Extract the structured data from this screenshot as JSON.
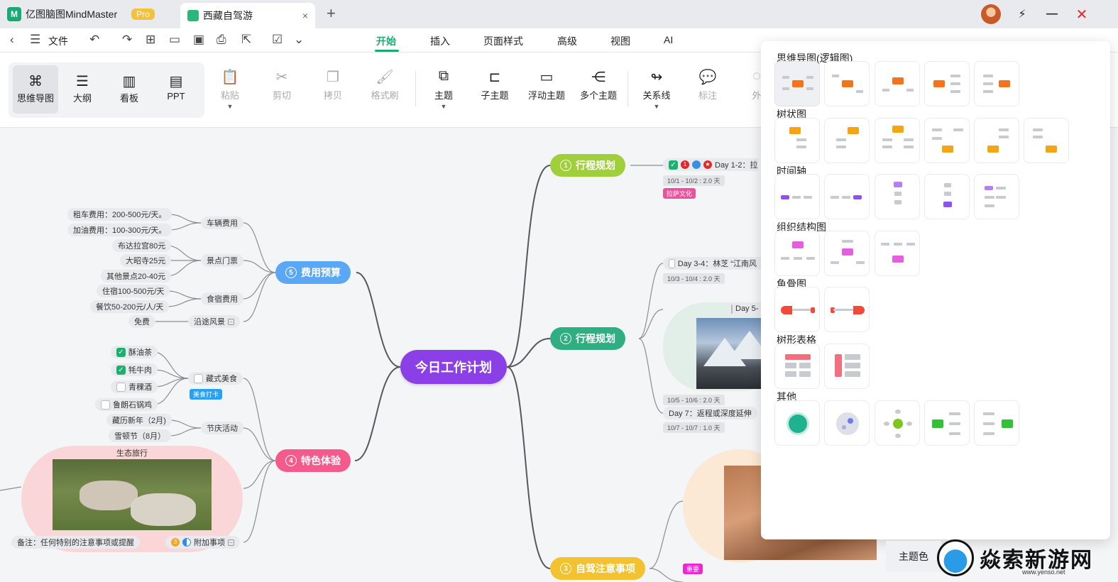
{
  "titlebar": {
    "app_name": "亿图脑图MindMaster",
    "pro_badge": "Pro",
    "doc_tab": "西藏自驾游",
    "close_symbol": "×",
    "new_tab_symbol": "+",
    "icons": [
      "app-logo-icon",
      "doc-icon",
      "avatar",
      "sync-icon",
      "minimize-icon",
      "close-icon"
    ]
  },
  "menubar": {
    "file": "文件",
    "tabs": [
      "开始",
      "插入",
      "页面样式",
      "高级",
      "视图",
      "AI"
    ],
    "active_tab": "开始",
    "accent": "#1aaa72"
  },
  "ribbon": {
    "views": [
      {
        "label": "思维导图",
        "icon": "mindmap-icon"
      },
      {
        "label": "大纲",
        "icon": "outline-icon"
      },
      {
        "label": "看板",
        "icon": "kanban-icon"
      },
      {
        "label": "PPT",
        "icon": "ppt-icon"
      }
    ],
    "tools": [
      {
        "label": "粘贴",
        "icon": "paste-icon",
        "enabled": false
      },
      {
        "label": "剪切",
        "icon": "cut-icon",
        "enabled": false
      },
      {
        "label": "拷贝",
        "icon": "copy-icon",
        "enabled": false
      },
      {
        "label": "格式刷",
        "icon": "format-brush-icon",
        "enabled": false
      },
      {
        "label": "主题",
        "icon": "topic-icon",
        "enabled": true
      },
      {
        "label": "子主题",
        "icon": "subtopic-icon",
        "enabled": true
      },
      {
        "label": "浮动主题",
        "icon": "floating-topic-icon",
        "enabled": true
      },
      {
        "label": "多个主题",
        "icon": "multi-topic-icon",
        "enabled": true
      },
      {
        "label": "关系线",
        "icon": "relation-line-icon",
        "enabled": true
      },
      {
        "label": "标注",
        "icon": "callout-icon",
        "enabled": false
      },
      {
        "label": "外",
        "icon": "boundary-icon",
        "enabled": false
      }
    ]
  },
  "mindmap": {
    "central": "今日工作计划",
    "branches": {
      "b1": {
        "num": "1",
        "label": "行程规划",
        "color": "#9fcf3a"
      },
      "b2": {
        "num": "2",
        "label": "行程规划",
        "color": "#2fae82"
      },
      "b3": {
        "num": "3",
        "label": "自驾注意事项",
        "color": "#f2c230"
      },
      "b4": {
        "num": "4",
        "label": "特色体验",
        "color": "#f45b8c"
      },
      "b5": {
        "num": "5",
        "label": "费用预算",
        "color": "#5aa8f5"
      }
    },
    "budget": {
      "car": "车辆费用",
      "car_rent": "租车费用：200-500元/天。",
      "car_fuel": "加油费用：100-300元/天。",
      "tickets": "景点门票",
      "t1": "布达拉宫80元",
      "t2": "大昭寺25元",
      "t3": "其他景点20-40元",
      "food": "食宿费用",
      "f1": "住宿100-500元/天",
      "f2": "餐饮50-200元/人/天",
      "scenery": "沿途风景",
      "free": "免费"
    },
    "experience": {
      "cuisine": "藏式美食",
      "c1": "酥油茶",
      "c2": "牦牛肉",
      "c3": "青稞酒",
      "c4": "鲁朗石锅鸡",
      "cuisine_tag": "美食打卡",
      "festival": "节庆活动",
      "fe1": "藏历新年（2月)",
      "fe2": "雪顿节（8月）",
      "eco": "生态旅行",
      "extra": "附加事项",
      "note": "备注：任何特别的注意事项或提醒"
    },
    "plan1": {
      "day": "Day 1-2：拉",
      "date": "10/1 - 10/2 : 2.0 天",
      "tag": "拉萨文化"
    },
    "plan2": {
      "day34": "Day 3-4：林芝 “江南风",
      "date34": "10/3 - 10/4 : 2.0 天",
      "day5": "Day 5-",
      "date5": "10/5 - 10/6 : 2.0 天",
      "day7": "Day 7：返程或深度延伸",
      "date7": "10/7 - 10/7 : 1.0 天"
    },
    "plan3": {
      "tag": "重要"
    }
  },
  "layout_panel": {
    "sections": [
      "思维导图(逻辑图)",
      "树状图",
      "时间轴",
      "组织结构图",
      "鱼骨图",
      "树形表格",
      "其他"
    ]
  },
  "bottom": {
    "theme_color": "主题色",
    "watermark_text": "焱索新游网",
    "watermark_url": "www.yenso.net"
  }
}
